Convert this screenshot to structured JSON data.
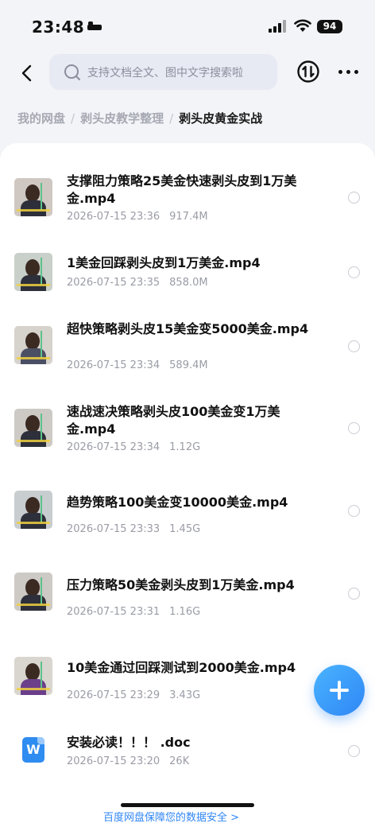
{
  "status": {
    "time": "23:48",
    "battery": "94"
  },
  "search": {
    "placeholder": "支持文档全文、图中文字搜索啦"
  },
  "breadcrumb": [
    "我的网盘",
    "剥头皮教学整理",
    "剥头皮黄金实战"
  ],
  "files": [
    {
      "name": "支撑阻力策略25美金快速剥头皮到1万美金.mp4",
      "date": "2026-07-15 23:36",
      "size": "917.4M",
      "type": "video"
    },
    {
      "name": "1美金回踩剥头皮到1万美金.mp4",
      "date": "2026-07-15 23:35",
      "size": "858.0M",
      "type": "video"
    },
    {
      "name": "超快策略剥头皮15美金变5000美金.mp4",
      "date": "2026-07-15 23:34",
      "size": "589.4M",
      "type": "video"
    },
    {
      "name": "速战速决策略剥头皮100美金变1万美金.mp4",
      "date": "2026-07-15 23:34",
      "size": "1.12G",
      "type": "video"
    },
    {
      "name": "趋势策略100美金变10000美金.mp4",
      "date": "2026-07-15 23:33",
      "size": "1.45G",
      "type": "video"
    },
    {
      "name": "压力策略50美金剥头皮到1万美金.mp4",
      "date": "2026-07-15 23:31",
      "size": "1.16G",
      "type": "video"
    },
    {
      "name": "10美金通过回踩测试到2000美金.mp4",
      "date": "2026-07-15 23:29",
      "size": "3.43G",
      "type": "video"
    },
    {
      "name": "安装必读！！！ .doc",
      "date": "2026-07-15 23:20",
      "size": "26K",
      "type": "doc"
    }
  ],
  "doc_icon_letter": "W",
  "footer_note": "百度网盘保障您的数据安全 >",
  "colors": {
    "accent": "#2f86f5",
    "background": "#f3f4f8"
  }
}
